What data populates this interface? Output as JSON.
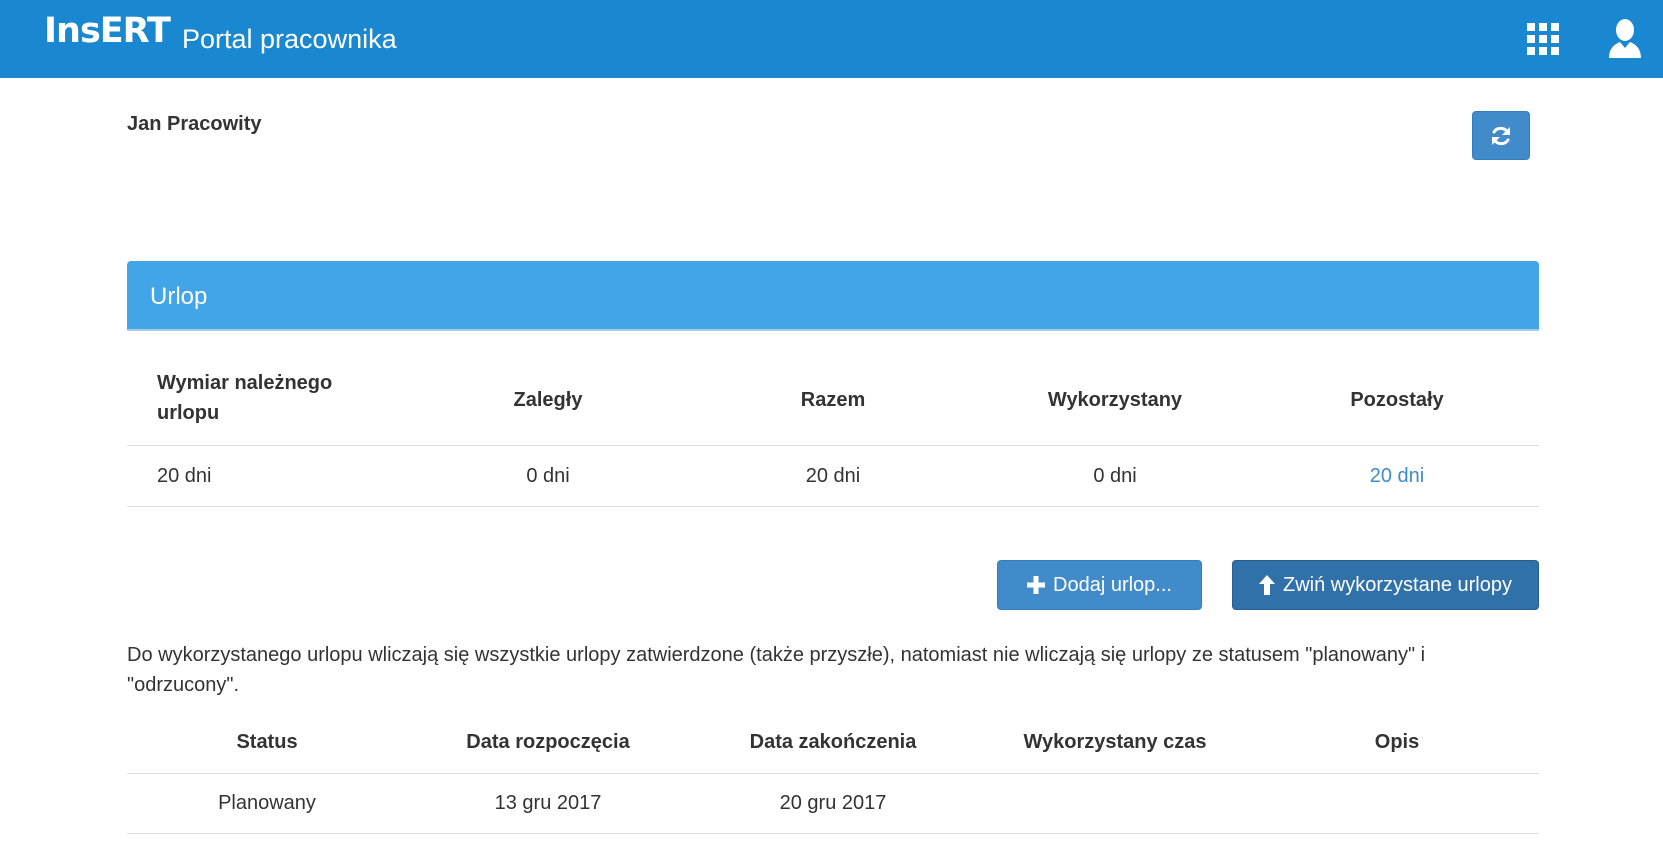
{
  "header": {
    "logo": "InsERT",
    "title": "Portal pracownika",
    "apps_icon": "grid-icon",
    "user_icon": "user-icon",
    "bg_color": "#1a87d1"
  },
  "employee": {
    "name": "Jan Pracowity"
  },
  "refresh_icon": "refresh-icon",
  "panel": {
    "title": "Urlop",
    "summary": {
      "headers": [
        "Wymiar należnego urlopu",
        "Zaległy",
        "Razem",
        "Wykorzystany",
        "Pozostały"
      ],
      "values": [
        "20 dni",
        "0 dni",
        "20 dni",
        "0 dni",
        "20 dni"
      ]
    },
    "buttons": {
      "add_label": "Dodaj urlop...",
      "collapse_label": "Zwiń wykorzystane urlopy"
    },
    "note": "Do wykorzystanego urlopu wliczają się wszystkie urlopy zatwierdzone (także przyszłe), natomiast nie wliczają się urlopy ze statusem \"planowany\" i \"odrzucony\".",
    "list": {
      "headers": [
        "Status",
        "Data rozpoczęcia",
        "Data zakończenia",
        "Wykorzystany czas",
        "Opis"
      ],
      "rows": [
        [
          "Planowany",
          "13 gru 2017",
          "20 gru 2017",
          "",
          ""
        ]
      ]
    }
  }
}
